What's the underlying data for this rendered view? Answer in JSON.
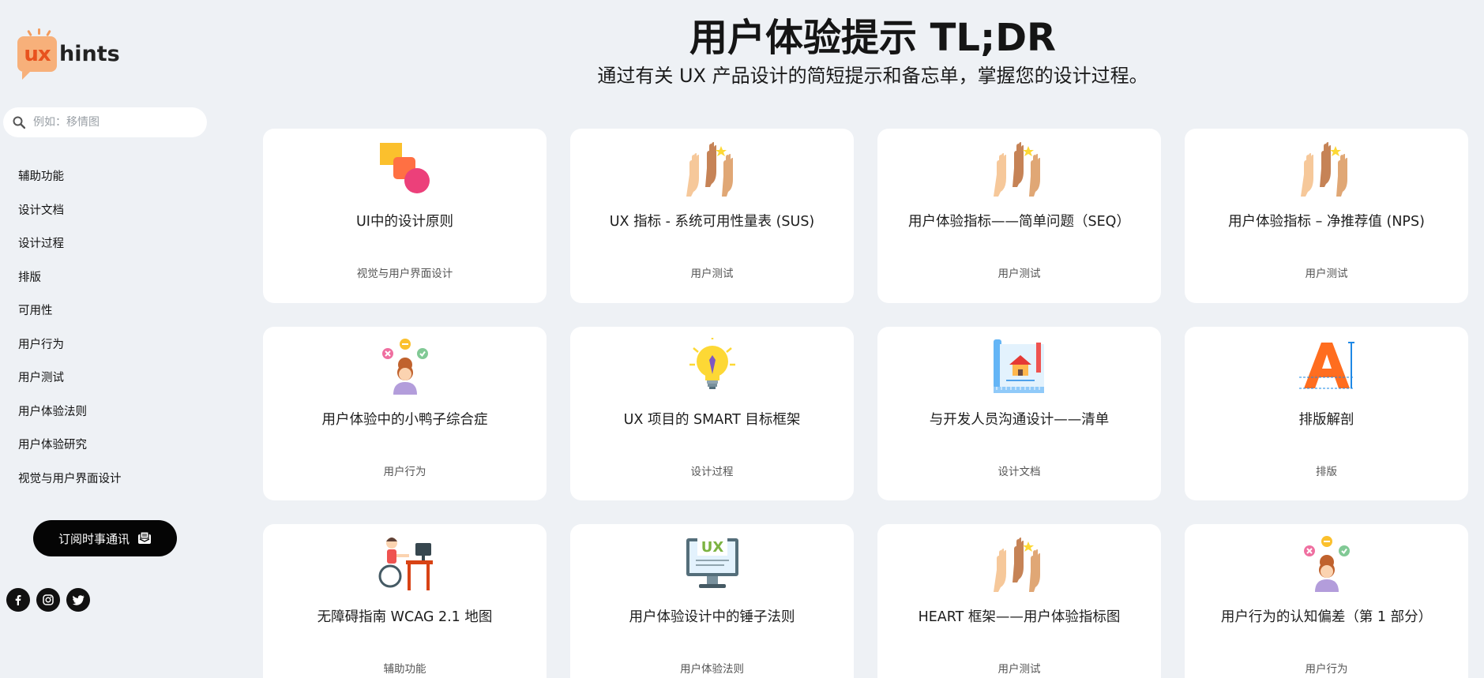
{
  "logo": {
    "badge": "ux",
    "text": "hints"
  },
  "search": {
    "placeholder": "例如：移情图"
  },
  "nav": [
    "辅助功能",
    "设计文档",
    "设计过程",
    "排版",
    "可用性",
    "用户行为",
    "用户测试",
    "用户体验法则",
    "用户体验研究",
    "视觉与用户界面设计"
  ],
  "subscribe": {
    "label": "订阅时事通讯"
  },
  "social": [
    "facebook",
    "instagram",
    "twitter"
  ],
  "header": {
    "title": "用户体验提示 TL;DR",
    "subtitle": "通过有关 UX 产品设计的简短提示和备忘单，掌握您的设计过程。"
  },
  "cards": [
    {
      "title": "UI中的设计原则",
      "category": "视觉与用户界面设计",
      "icon": "shapes-icon"
    },
    {
      "title": "UX 指标 - 系统可用性量表 (SUS)",
      "category": "用户测试",
      "icon": "raised-hands-icon"
    },
    {
      "title": "用户体验指标——简单问题（SEQ）",
      "category": "用户测试",
      "icon": "raised-hands-icon"
    },
    {
      "title": "用户体验指标 – 净推荐值 (NPS)",
      "category": "用户测试",
      "icon": "raised-hands-icon"
    },
    {
      "title": "用户体验中的小鸭子综合症",
      "category": "用户行为",
      "icon": "girl-choices-icon"
    },
    {
      "title": "UX 项目的 SMART 目标框架",
      "category": "设计过程",
      "icon": "lightbulb-icon"
    },
    {
      "title": "与开发人员沟通设计——清单",
      "category": "设计文档",
      "icon": "blueprint-house-icon"
    },
    {
      "title": "排版解剖",
      "category": "排版",
      "icon": "letter-a-icon"
    },
    {
      "title": "无障碍指南 WCAG 2.1 地图",
      "category": "辅助功能",
      "icon": "wheelchair-desk-icon"
    },
    {
      "title": "用户体验设计中的锤子法则",
      "category": "用户体验法则",
      "icon": "ux-monitor-icon"
    },
    {
      "title": "HEART 框架——用户体验指标图",
      "category": "用户测试",
      "icon": "raised-hands-icon"
    },
    {
      "title": "用户行为的认知偏差（第 1 部分）",
      "category": "用户行为",
      "icon": "girl-choices-icon"
    }
  ],
  "colors": {
    "background": "#eef1f5",
    "card": "#ffffff",
    "accent": "#f7b07a",
    "button": "#050505"
  }
}
